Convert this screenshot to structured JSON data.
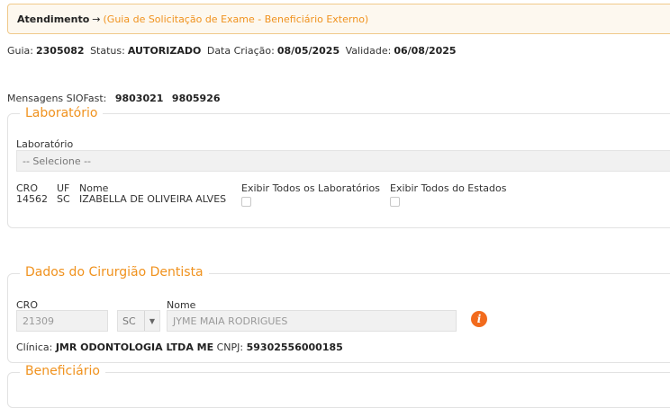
{
  "breadcrumb": {
    "main": "Atendimento",
    "arrow": "→",
    "sub": "(Guia de Solicitação de Exame - Beneficiário Externo)"
  },
  "guia_info": {
    "guia_label": "Guia:",
    "guia_value": "2305082",
    "status_label": "Status:",
    "status_value": "AUTORIZADO",
    "data_criacao_label": "Data Criação:",
    "data_criacao_value": "08/05/2025",
    "validade_label": "Validade:",
    "validade_value": "06/08/2025"
  },
  "mensagens": {
    "label": "Mensagens SIOFast:",
    "codes": [
      "9803021",
      "9805926"
    ]
  },
  "laboratorio": {
    "legend": "Laboratório",
    "select_label": "Laboratório",
    "select_value": "-- Selecione --",
    "cro_header": "CRO",
    "uf_header": "UF",
    "nome_header": "Nome",
    "cro_value": "14562",
    "uf_value": "SC",
    "nome_value": "IZABELLA DE OLIVEIRA ALVES",
    "checkbox_todos_labs": "Exibir Todos os Laboratórios",
    "checkbox_todos_estados": "Exibir Todos do Estados"
  },
  "cirurgiao": {
    "legend": "Dados do Cirurgião Dentista",
    "cro_label": "CRO",
    "cro_value": "21309",
    "uf_value": "SC",
    "nome_label": "Nome",
    "nome_value": "JYME MAIA RODRIGUES",
    "clinica_label": "Clínica:",
    "clinica_value": "JMR ODONTOLOGIA LTDA ME",
    "cnpj_label": "CNPJ:",
    "cnpj_value": "59302556000185",
    "info_icon": "i"
  },
  "beneficiario": {
    "legend": "Beneficiário"
  },
  "colors": {
    "accent": "#f0921e",
    "info_icon_bg": "#f26b1d",
    "breadcrumb_bg": "#fdf8ef",
    "breadcrumb_border": "#f0c98a"
  }
}
